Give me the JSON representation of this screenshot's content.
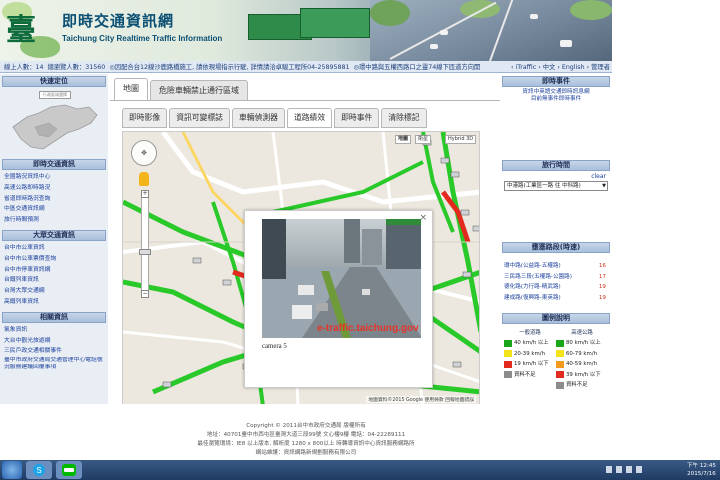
{
  "header": {
    "logo_glyph": "臺中",
    "title": "即時交通資訊網",
    "subtitle": "Taichung City Realtime Traffic Information"
  },
  "ticker": {
    "online": "線上人數：14",
    "visits": "總瀏覽人數：31560",
    "news_1": "◎因配合台12線沙鹿路橋施工, 請依現場指示行駛, 詳情請洽卓駿工程所04-25895881",
    "news_2": "◎環中路與五權西路口之靈74線下匝道方向開",
    "lang_links": "‹ iTraffic  › 中文  › English  › 管理者"
  },
  "left_sidebar": {
    "quick_locate": "快速定位",
    "district_select": "行政區域選擇",
    "sections": [
      {
        "title": "即時交通資訊",
        "links": [
          "全國路況資訊中心",
          "高速公路即時路況",
          "省道即時路況查詢",
          "中區交通資訊網",
          "旅行時間預測"
        ]
      },
      {
        "title": "大眾交通資訊",
        "links": [
          "台中市公車資訊",
          "台中市公車票價查詢",
          "台中市停車資訊網",
          "台鐵列車資訊",
          "台灣大眾交通網",
          "高鐵列車資訊"
        ]
      },
      {
        "title": "相關資訊",
        "links": [
          "氣象資訊",
          "大台中觀光旅遊網",
          "三民戶政交通相關事件",
          "臺中市政府交通局交通管理中心電話號",
          "況服務建議回覆事項"
        ]
      }
    ]
  },
  "main": {
    "top_tabs": [
      "地圖",
      "危險車輛禁止通行區域"
    ],
    "sub_tabs": [
      "即時影像",
      "資訊可變標誌",
      "車輛偵測器",
      "道路績效",
      "即時事件",
      "清除標記"
    ],
    "map_types": [
      "地圖",
      "衛星",
      "Hybrid 3D"
    ],
    "map_credit": "地圖資料©2015 Google  使用條款  回報地圖錯誤",
    "popup": {
      "close": "×",
      "watermark": "e-traffic.taichung.gov",
      "camera_label": "camera 5"
    }
  },
  "right_sidebar": {
    "events_title": "即時事件",
    "event_links": [
      "資訊中英語交通即時訊息網",
      "目前無事件即時事件"
    ],
    "travel_title": "旅行時間",
    "clear": "clear",
    "route_select": "中港路(工業區一路 往 中科路)",
    "congestion_title": "壅塞路段(時速)",
    "roads": [
      {
        "name": "環中路(公益路-五權路)",
        "speed": "16"
      },
      {
        "name": "三民路三段(五權路-公園路)",
        "speed": "17"
      },
      {
        "name": "德化路(力行路-精武路)",
        "speed": "19"
      },
      {
        "name": "建成路(復興路-東英路)",
        "speed": "19"
      }
    ],
    "legend_title": "圖例說明",
    "legend_headers": [
      "一般道路",
      "高速公路"
    ],
    "legend_rows": [
      {
        "general": "40 km/h 以上",
        "general_color": "#1aa51a",
        "highway": "80 km/h 以上",
        "highway_color": "#1aa51a"
      },
      {
        "general": "20-39 km/h",
        "general_color": "#f3e31b",
        "highway": "60-79 km/h",
        "highway_color": "#f3e31b"
      },
      {
        "general": "19 km/h 以下",
        "general_color": "#e22a1f",
        "highway": "40-59 km/h",
        "highway_color": "#f29a1b"
      },
      {
        "general": "資料不足",
        "general_color": "#8c8c8c",
        "highway": "39 km/h 以下",
        "highway_color": "#e22a1f"
      },
      {
        "general": "",
        "general_color": "",
        "highway": "資料不足",
        "highway_color": "#8c8c8c"
      }
    ]
  },
  "footer": {
    "copyright": "Copyright © 2011台中市政府交通局 版權所有",
    "address": "地址：40701臺中市西屯區臺灣大道三段99號 文心樓9樓  電話：04-22289111",
    "resolution": "最佳瀏覽環境：IE8 以上版本, 解析度 1280 x 800以上  時轉導資訊中心資訊服務網路所",
    "maintainer": "網站維護：資訊網路新規劃服務有限公司"
  },
  "taskbar": {
    "time": "下午 12:45",
    "date": "2015/7/16"
  }
}
